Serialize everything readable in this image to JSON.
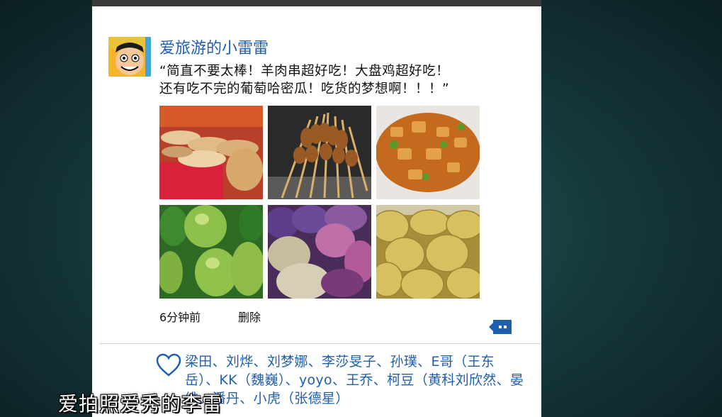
{
  "post": {
    "username": "爱旅游的小雷雷",
    "quote_line1": "“简直不要太棒！羊肉串超好吃！大盘鸡超好吃！",
    "quote_line2": "还有吃不完的葡萄哈密瓜！吃货的梦想啊！！！”",
    "time": "6分钟前",
    "delete_label": "删除",
    "photos": [
      "naan-bread-stall",
      "lamb-skewers",
      "big-plate-chicken",
      "green-fruits",
      "raisins-piles",
      "hami-melons"
    ]
  },
  "likes": {
    "names": [
      "梁田、",
      "刘烨、",
      "刘梦娜、",
      "李莎旻子、",
      "孙璞、",
      "E哥（王东岳）、",
      "KK（魏巍）、",
      "yoyo、",
      "王乔、",
      "柯豆（黄科",
      "刘欣然、",
      "晏维、",
      "潘丹、",
      "小虎（张德星）"
    ],
    "partial_next_line": "……"
  },
  "caption": {
    "subtitle": "爱拍照爱秀的李雷"
  },
  "colors": {
    "link_blue": "#1f5fb0",
    "background": "#173a3e",
    "card": "#ffffff"
  }
}
